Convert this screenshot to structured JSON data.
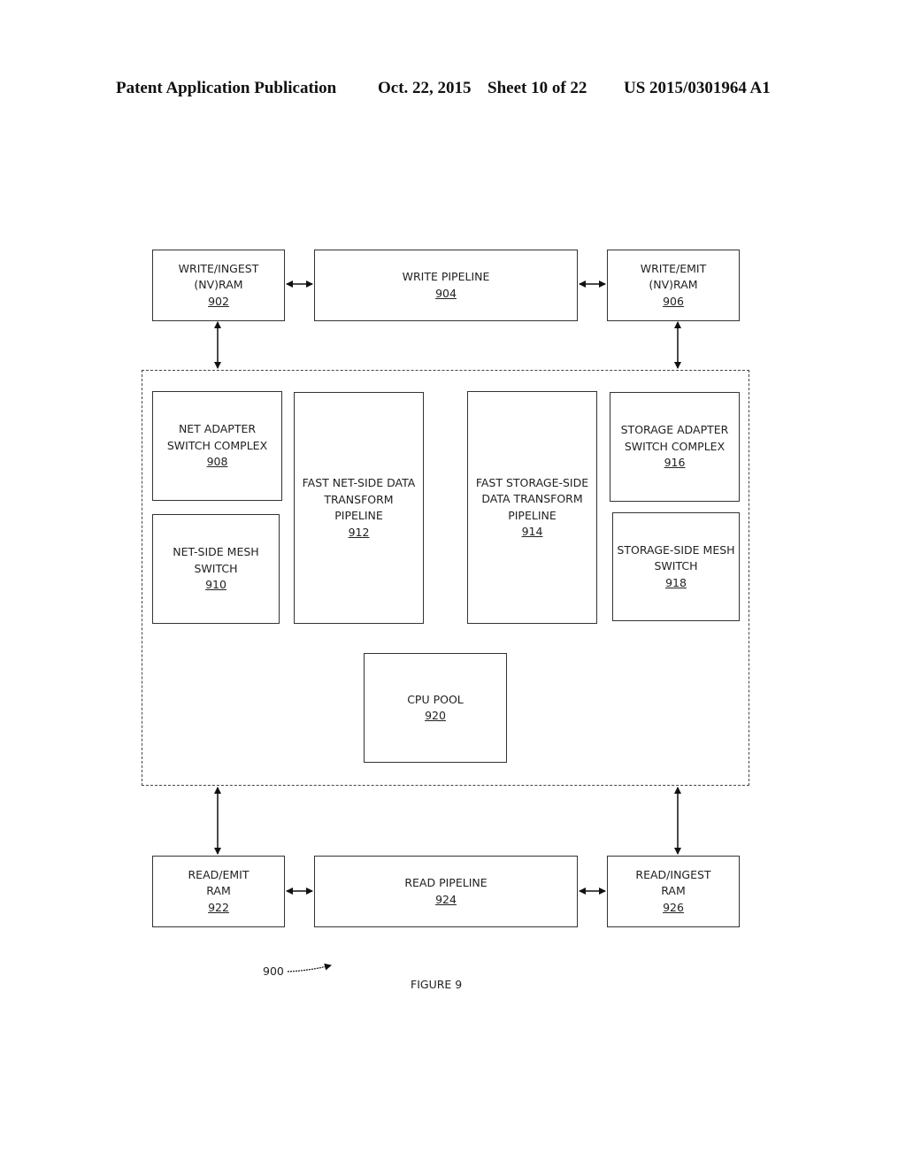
{
  "header": {
    "publication": "Patent Application Publication",
    "date": "Oct. 22, 2015",
    "sheet": "Sheet 10 of 22",
    "number": "US 2015/0301964 A1"
  },
  "blocks": {
    "b902": {
      "label": "WRITE/INGEST\n(NV)RAM",
      "ref": "902"
    },
    "b904": {
      "label": "WRITE PIPELINE",
      "ref": "904"
    },
    "b906": {
      "label": "WRITE/EMIT\n(NV)RAM",
      "ref": "906"
    },
    "b908": {
      "label": "NET ADAPTER\nSWITCH COMPLEX",
      "ref": "908"
    },
    "b910": {
      "label": "NET-SIDE MESH\nSWITCH",
      "ref": "910"
    },
    "b912": {
      "label": "FAST NET-SIDE DATA\nTRANSFORM\nPIPELINE",
      "ref": "912"
    },
    "b914": {
      "label": "FAST STORAGE-SIDE\nDATA TRANSFORM\nPIPELINE",
      "ref": "914"
    },
    "b916": {
      "label": "STORAGE ADAPTER\nSWITCH COMPLEX",
      "ref": "916"
    },
    "b918": {
      "label": "STORAGE-SIDE MESH\nSWITCH",
      "ref": "918"
    },
    "b920": {
      "label": "CPU POOL",
      "ref": "920"
    },
    "b922": {
      "label": "READ/EMIT\nRAM",
      "ref": "922"
    },
    "b924": {
      "label": "READ PIPELINE",
      "ref": "924"
    },
    "b926": {
      "label": "READ/INGEST\nRAM",
      "ref": "926"
    }
  },
  "figure": {
    "ref": "900",
    "caption": "FIGURE 9"
  }
}
